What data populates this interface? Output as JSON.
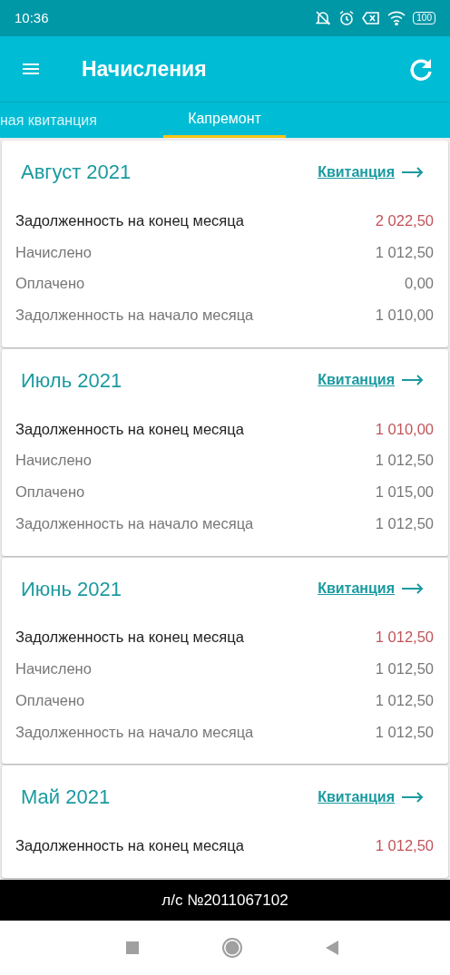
{
  "status_bar": {
    "time": "10:36",
    "battery": "100"
  },
  "app_bar": {
    "title": "Начисления"
  },
  "tabs": [
    {
      "label": "ная квитанция",
      "selected": false
    },
    {
      "label": "Капремонт",
      "selected": true
    }
  ],
  "months": [
    {
      "title": "Август 2021",
      "link": "Квитанция",
      "rows": [
        {
          "kind": "total",
          "label": "Задолженность на конец месяца",
          "value": "2 022,50"
        },
        {
          "kind": "item",
          "label": "Начислено",
          "value": "1 012,50"
        },
        {
          "kind": "item",
          "label": "Оплачено",
          "value": "0,00"
        },
        {
          "kind": "item",
          "label": "Задолженность на начало месяца",
          "value": "1 010,00"
        }
      ]
    },
    {
      "title": "Июль 2021",
      "link": "Квитанция",
      "rows": [
        {
          "kind": "total",
          "label": "Задолженность на конец месяца",
          "value": "1 010,00"
        },
        {
          "kind": "item",
          "label": "Начислено",
          "value": "1 012,50"
        },
        {
          "kind": "item",
          "label": "Оплачено",
          "value": "1 015,00"
        },
        {
          "kind": "item",
          "label": "Задолженность на начало месяца",
          "value": "1 012,50"
        }
      ]
    },
    {
      "title": "Июнь 2021",
      "link": "Квитанция",
      "rows": [
        {
          "kind": "total",
          "label": "Задолженность на конец месяца",
          "value": "1 012,50"
        },
        {
          "kind": "item",
          "label": "Начислено",
          "value": "1 012,50"
        },
        {
          "kind": "item",
          "label": "Оплачено",
          "value": "1 012,50"
        },
        {
          "kind": "item",
          "label": "Задолженность на начало месяца",
          "value": "1 012,50"
        }
      ]
    },
    {
      "title": "Май 2021",
      "link": "Квитанция",
      "rows": [
        {
          "kind": "total",
          "label": "Задолженность на конец месяца",
          "value": "1 012,50"
        }
      ]
    }
  ],
  "footer": {
    "account": "л/с №2011067102"
  }
}
